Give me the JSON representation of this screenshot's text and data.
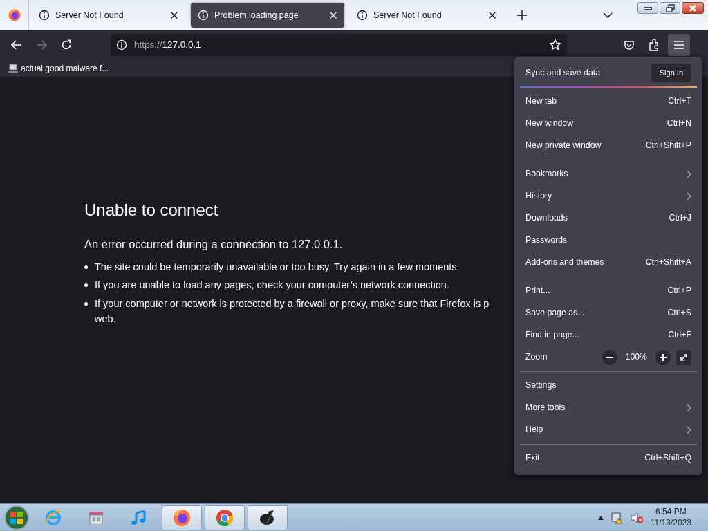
{
  "tabs": [
    {
      "label": "Server Not Found",
      "selected": false
    },
    {
      "label": "Problem loading page",
      "selected": true
    },
    {
      "label": "Server Not Found",
      "selected": false
    }
  ],
  "address": {
    "scheme": "https://",
    "host": "127.0.0.1"
  },
  "bookmarks": [
    {
      "label": "actual good malware f..."
    }
  ],
  "error_page": {
    "title": "Unable to connect",
    "lead": "An error occurred during a connection to 127.0.0.1.",
    "bullets": [
      {
        "text": "The site could be temporarily unavailable or too busy. Try again in a few moments."
      },
      {
        "text": "If you are unable to load any pages, check your computer’s network connection."
      },
      {
        "text": "If your computer or network is protected by a firewall or proxy, make sure that Firefox is p",
        "continuation": "web."
      }
    ]
  },
  "menu": {
    "sync_label": "Sync and save data",
    "sign_in": "Sign In",
    "groups": [
      [
        {
          "kind": "item",
          "label": "New tab",
          "shortcut": "Ctrl+T"
        },
        {
          "kind": "item",
          "label": "New window",
          "shortcut": "Ctrl+N"
        },
        {
          "kind": "item",
          "label": "New private window",
          "shortcut": "Ctrl+Shift+P"
        }
      ],
      [
        {
          "kind": "submenu",
          "label": "Bookmarks"
        },
        {
          "kind": "submenu",
          "label": "History"
        },
        {
          "kind": "item",
          "label": "Downloads",
          "shortcut": "Ctrl+J"
        },
        {
          "kind": "item",
          "label": "Passwords"
        },
        {
          "kind": "item",
          "label": "Add-ons and themes",
          "shortcut": "Ctrl+Shift+A"
        }
      ],
      [
        {
          "kind": "item",
          "label": "Print...",
          "shortcut": "Ctrl+P"
        },
        {
          "kind": "item",
          "label": "Save page as...",
          "shortcut": "Ctrl+S"
        },
        {
          "kind": "item",
          "label": "Find in page...",
          "shortcut": "Ctrl+F"
        },
        {
          "kind": "zoom",
          "label": "Zoom",
          "value": "100%"
        }
      ],
      [
        {
          "kind": "item",
          "label": "Settings"
        },
        {
          "kind": "submenu",
          "label": "More tools"
        },
        {
          "kind": "submenu",
          "label": "Help"
        }
      ],
      [
        {
          "kind": "item",
          "label": "Exit",
          "shortcut": "Ctrl+Shift+Q"
        }
      ]
    ]
  },
  "taskbar": {
    "apps": [
      {
        "kind": "ie",
        "open": false
      },
      {
        "kind": "archive",
        "open": false
      },
      {
        "kind": "music",
        "open": false
      },
      {
        "kind": "firefox",
        "open": true
      },
      {
        "kind": "chrome",
        "open": true
      },
      {
        "kind": "paint",
        "open": true
      }
    ],
    "time": "6:54 PM",
    "date": "11/13/2023"
  }
}
